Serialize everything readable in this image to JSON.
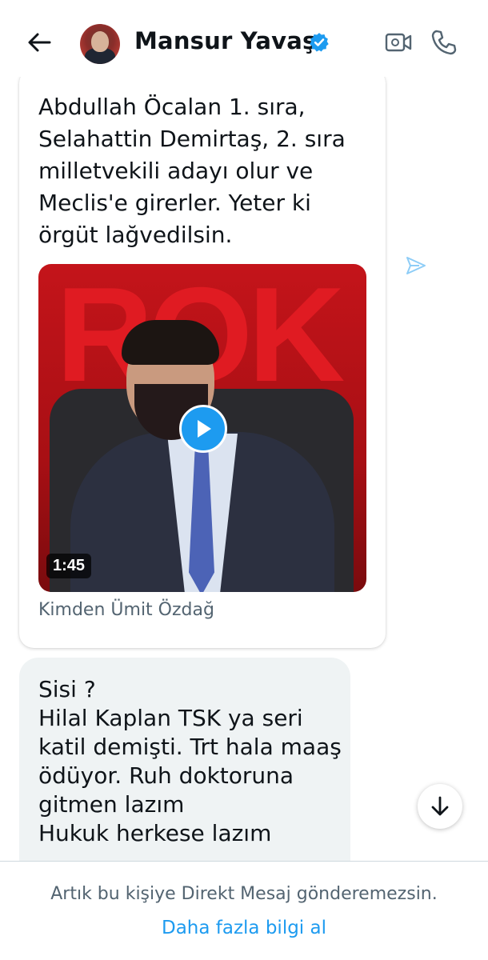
{
  "header": {
    "contact_name": "Mansur Yavaş",
    "icons": {
      "back": "back-arrow-icon",
      "verified": "verified-badge-icon",
      "video": "video-call-icon",
      "call": "phone-call-icon"
    }
  },
  "messages": [
    {
      "type": "received",
      "text": "Abdullah Öcalan 1. sıra,\nSelahattin Demirtaş, 2. sıra\nmilletvekili adayı olur ve\nMeclis'e girerler. Yeter ki\nörgüt lağvedilsin.",
      "media": {
        "thumbnail_text": "ROK",
        "duration": "1:45",
        "play_icon": "play-icon"
      },
      "source": "Kimden Ümit Özdağ"
    },
    {
      "type": "sent",
      "text": "Sisi ?\nHilal Kaplan TSK ya seri\nkatil demişti. Trt hala maaş\nödüyor. Ruh doktoruna\ngitmen lazım\nHukuk herkese lazım"
    }
  ],
  "footer": {
    "notice": "Artık bu kişiye Direkt Mesaj gönderemezsin.",
    "link": "Daha fazla bilgi al"
  },
  "colors": {
    "accent": "#1d9bf0",
    "text": "#0f1419",
    "secondary_text": "#536471",
    "sent_bubble": "#eff3f4"
  }
}
